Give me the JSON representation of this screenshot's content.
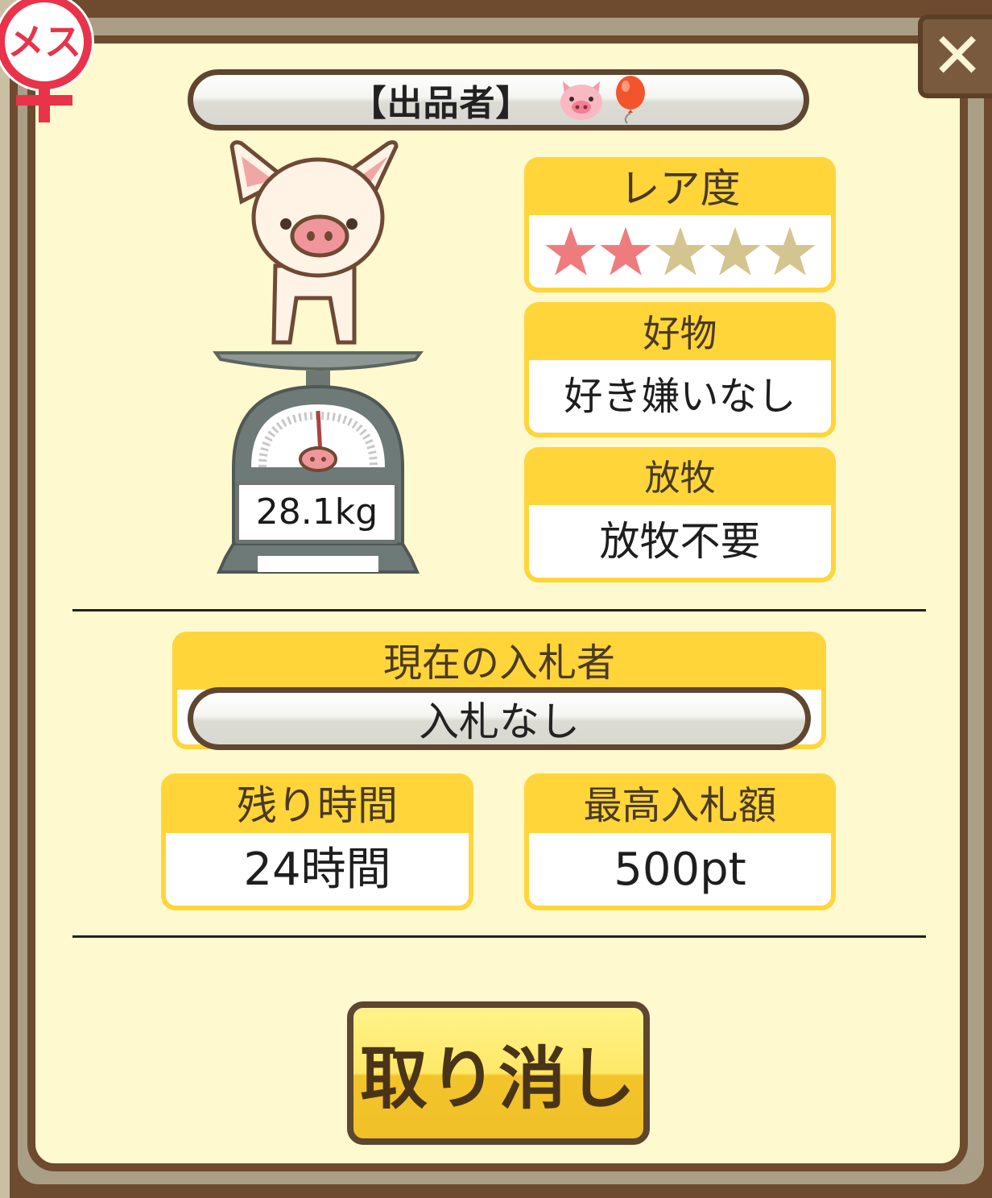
{
  "badge": {
    "label": "メス",
    "color": "#e8334a"
  },
  "seller": {
    "label": "【出品者】",
    "icons": [
      "pig-face-icon",
      "balloon-icon"
    ]
  },
  "pig": {
    "weight": "28.1kg"
  },
  "rarity": {
    "label": "レア度",
    "rating": 2,
    "max": 5,
    "filled_color": "#ee7c7e",
    "empty_color": "#d4c48f"
  },
  "favorite_food": {
    "label": "好物",
    "value": "好き嫌いなし"
  },
  "grazing": {
    "label": "放牧",
    "value": "放牧不要"
  },
  "current_bidder": {
    "label": "現在の入札者",
    "value": "入札なし"
  },
  "time_left": {
    "label": "残り時間",
    "value": "24時間"
  },
  "highest_bid": {
    "label": "最高入札額",
    "value": "500pt"
  },
  "actions": {
    "cancel_label": "取り消し",
    "close_icon": "close-icon"
  },
  "colors": {
    "panel": "#fff9cf",
    "frame": "#6e4a2f",
    "card_header": "#ffd53a",
    "button": "#fde867"
  }
}
